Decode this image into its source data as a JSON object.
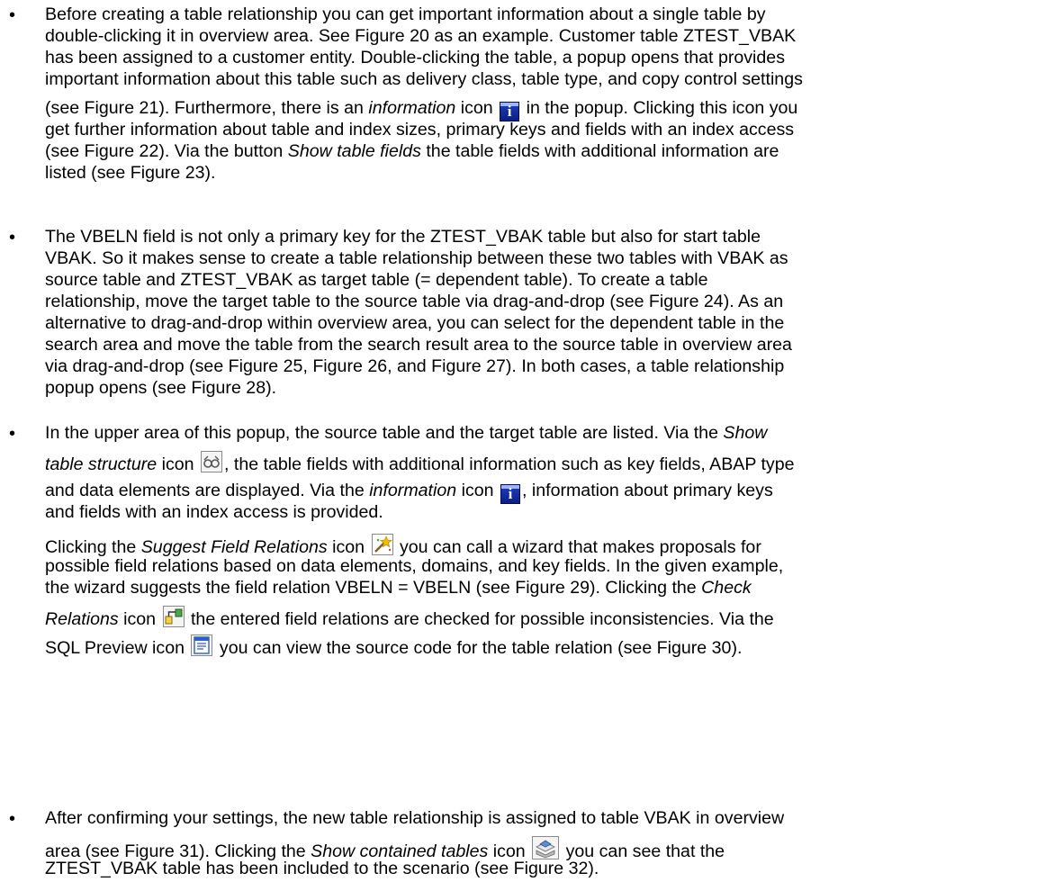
{
  "bullet_glyph": "•",
  "items": [
    {
      "lines": [
        [
          {
            "t": "Before creating a table relationship you can get important information about a single table by"
          }
        ],
        [
          {
            "t": "double-clicking it in overview area. See Figure 20 as an example. Customer table ZTEST_VBAK"
          }
        ],
        [
          {
            "t": "has been assigned to a customer entity. Double-clicking the table, a popup opens that provides"
          }
        ],
        [
          {
            "t": "important information about this table such as delivery class, table type, and copy control settings"
          }
        ],
        [
          {
            "t": "(see Figure 21). Furthermore, there is an "
          },
          {
            "t": "information",
            "i": true
          },
          {
            "t": " icon "
          },
          {
            "icon": "info-icon"
          },
          {
            "t": " in the popup. Clicking this icon you"
          }
        ],
        [
          {
            "t": "get further information about table and index sizes, primary keys and fields with an index access"
          }
        ],
        [
          {
            "t": "(see Figure 22). Via the button "
          },
          {
            "t": "Show table fields",
            "i": true
          },
          {
            "t": " the table fields with additional information are"
          }
        ],
        [
          {
            "t": "listed (see Figure 23)."
          }
        ]
      ]
    },
    {
      "lines": [
        [
          {
            "t": "The VBELN field is not only a primary key for the ZTEST_VBAK table but also for start table"
          }
        ],
        [
          {
            "t": "VBAK. So it makes sense to create a table relationship between these two tables with VBAK as"
          }
        ],
        [
          {
            "t": "source table and ZTEST_VBAK as target table (= dependent table). To create a table"
          }
        ],
        [
          {
            "t": "relationship, move the target table to the source table via drag-and-drop (see Figure 24). As an"
          }
        ],
        [
          {
            "t": "alternative to drag-and-drop within overview area, you can select for the dependent table in the"
          }
        ],
        [
          {
            "t": "search area and move the table from the search result area to the source table in overview area"
          }
        ],
        [
          {
            "t": "via drag-and-drop (see Figure 25, Figure 26, and Figure 27). In both cases, a table relationship"
          }
        ],
        [
          {
            "t": "popup opens (see Figure 28)."
          }
        ]
      ]
    },
    {
      "paras": [
        {
          "lines": [
            [
              {
                "t": "In the upper area of this popup, the source table and the target table are listed. Via the "
              },
              {
                "t": "Show",
                "i": true
              }
            ],
            [
              {
                "t": "table structure",
                "i": true
              },
              {
                "t": " icon "
              },
              {
                "icon": "glasses-icon"
              },
              {
                "t": ", the table fields with additional information such as key fields, ABAP type"
              }
            ],
            [
              {
                "t": "and data elements are displayed. Via the "
              },
              {
                "t": "information",
                "i": true
              },
              {
                "t": " icon "
              },
              {
                "icon": "info-icon"
              },
              {
                "t": ", information about primary keys"
              }
            ],
            [
              {
                "t": "and fields with an index access is provided."
              }
            ]
          ]
        },
        {
          "lines": [
            [
              {
                "t": "Clicking the "
              },
              {
                "t": "Suggest Field Relations",
                "i": true
              },
              {
                "t": " icon "
              },
              {
                "icon": "wand-icon"
              },
              {
                "t": " you can call a wizard that makes proposals for"
              }
            ],
            [
              {
                "t": "possible field relations based on data elements, domains, and key fields. In the given example,"
              }
            ],
            [
              {
                "t": "the wizard suggests the field relation VBELN = VBELN (see Figure 29). Clicking the "
              },
              {
                "t": "Check",
                "i": true
              }
            ],
            [
              {
                "t": "Relations",
                "i": true
              },
              {
                "t": " icon "
              },
              {
                "icon": "check-relations-icon"
              },
              {
                "t": " the entered field relations are checked for possible inconsistencies. Via the"
              }
            ],
            [
              {
                "t": "SQL Preview icon "
              },
              {
                "icon": "sql-preview-icon"
              },
              {
                "t": " you can view the source code for the table relation (see Figure 30)."
              }
            ]
          ]
        }
      ]
    },
    {
      "lines": [
        [
          {
            "t": "After confirming your settings, the new table relationship is assigned to table VBAK in overview"
          }
        ],
        [
          {
            "t": "area (see Figure 31). Clicking the "
          },
          {
            "t": "Show contained tables",
            "i": true
          },
          {
            "t": " icon "
          },
          {
            "icon": "contained-tables-icon"
          },
          {
            "t": " you can see that the"
          }
        ],
        [
          {
            "t": "ZTEST_VBAK table has been included to the scenario (see Figure 32)."
          }
        ]
      ]
    }
  ]
}
